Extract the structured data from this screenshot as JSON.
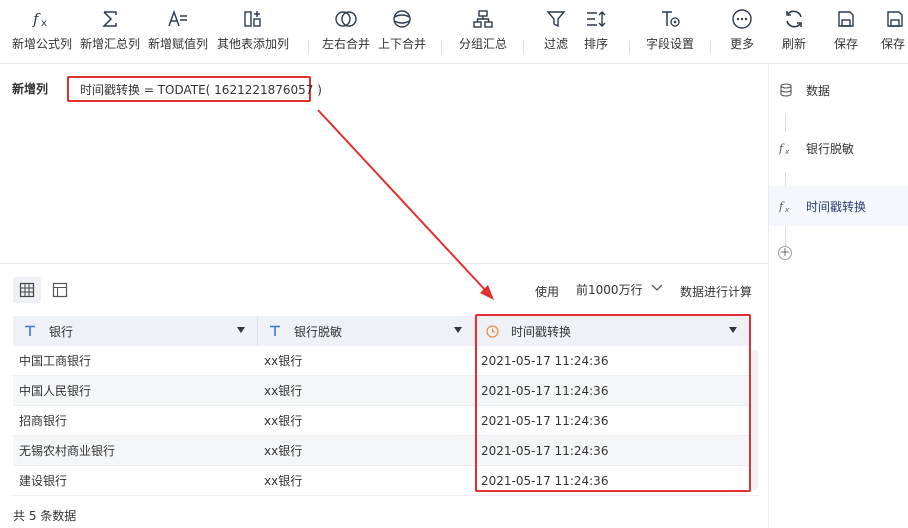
{
  "toolbar": {
    "items": [
      {
        "label": "新增公式列",
        "icon": "fx-icon"
      },
      {
        "label": "新增汇总列",
        "icon": "sigma-icon"
      },
      {
        "label": "新增赋值列",
        "icon": "assign-icon"
      },
      {
        "label": "其他表添加列",
        "icon": "add-column-icon"
      },
      {
        "label": "左右合并",
        "icon": "merge-horizontal-icon"
      },
      {
        "label": "上下合并",
        "icon": "merge-vertical-icon"
      },
      {
        "label": "分组汇总",
        "icon": "group-summary-icon"
      },
      {
        "label": "过滤",
        "icon": "filter-icon"
      },
      {
        "label": "排序",
        "icon": "sort-icon"
      },
      {
        "label": "字段设置",
        "icon": "field-settings-icon"
      },
      {
        "label": "更多",
        "icon": "more-icon"
      },
      {
        "label": "刷新",
        "icon": "refresh-icon"
      },
      {
        "label": "保存",
        "icon": "save-icon"
      },
      {
        "label": "保存",
        "icon": "save-as-icon"
      }
    ]
  },
  "formula": {
    "section_label": "新增列",
    "expression": "时间戳转换 = TODATE( 1621221876057 )"
  },
  "steps": [
    {
      "label": "数据",
      "icon": "database-icon",
      "active": false
    },
    {
      "label": "银行脱敏",
      "icon": "fx-icon",
      "active": false
    },
    {
      "label": "时间戳转换",
      "icon": "fx-icon",
      "active": true
    }
  ],
  "preview": {
    "use_label": "使用",
    "rows_option": "前1000万行",
    "calc_label": "数据进行计算"
  },
  "table": {
    "columns": [
      {
        "label": "银行",
        "type_icon": "text-type-icon"
      },
      {
        "label": "银行脱敏",
        "type_icon": "text-type-icon"
      },
      {
        "label": "时间戳转换",
        "type_icon": "clock-icon"
      }
    ],
    "rows": [
      [
        "中国工商银行",
        "xx银行",
        "2021-05-17 11:24:36"
      ],
      [
        "中国人民银行",
        "xx银行",
        "2021-05-17 11:24:36"
      ],
      [
        "招商银行",
        "xx银行",
        "2021-05-17 11:24:36"
      ],
      [
        "无锡农村商业银行",
        "xx银行",
        "2021-05-17 11:24:36"
      ],
      [
        "建设银行",
        "xx银行",
        "2021-05-17 11:24:36"
      ]
    ]
  },
  "footer": {
    "count_text": "共 5 条数据"
  },
  "colors": {
    "highlight": "#e03131",
    "accent": "#3a78d4",
    "clock": "#f0883e"
  }
}
